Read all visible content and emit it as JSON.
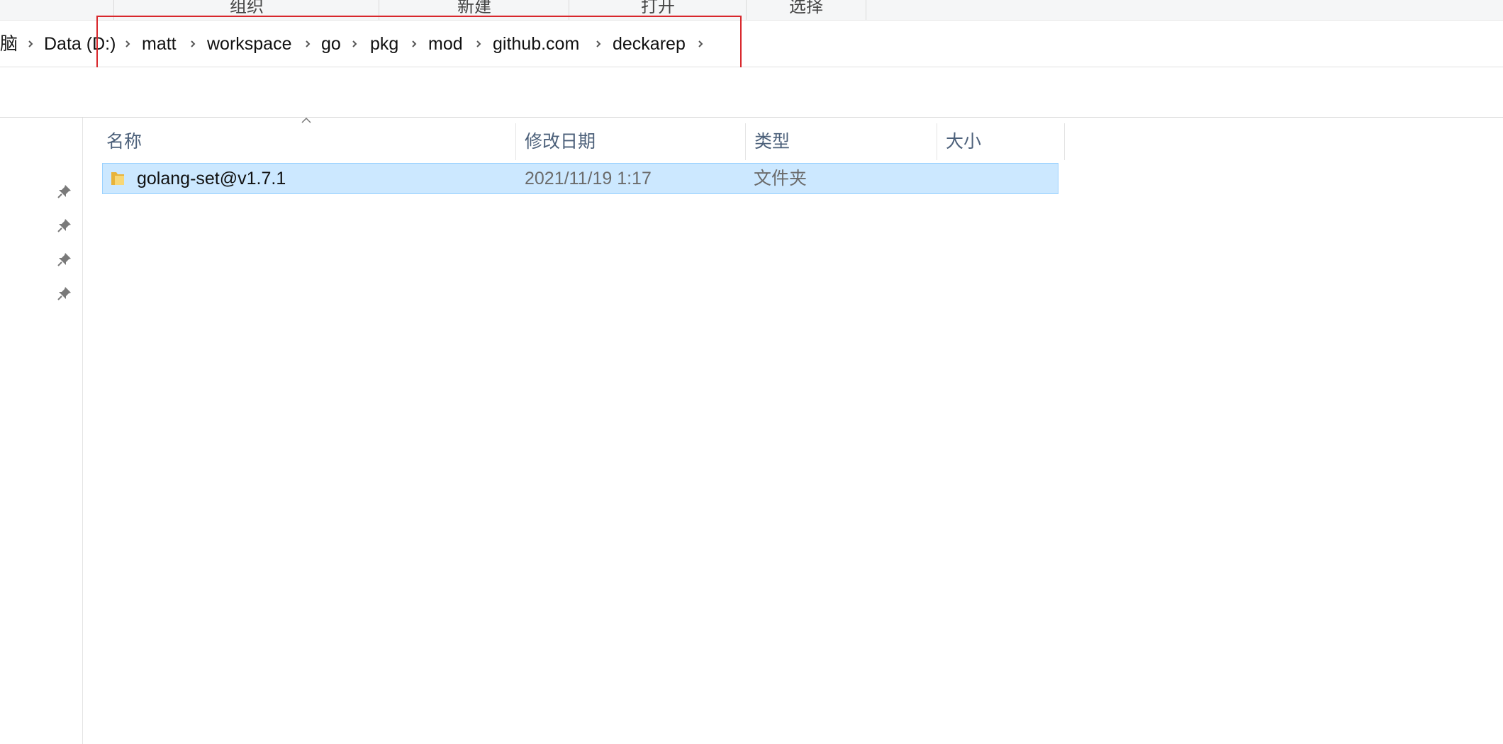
{
  "ribbon": {
    "groups": [
      "组织",
      "新建",
      "打开",
      "选择"
    ]
  },
  "address_bar": {
    "crumbs": [
      "脑",
      "Data (D:)",
      "matt",
      "workspace",
      "go",
      "pkg",
      "mod",
      "github.com",
      "deckarep"
    ]
  },
  "columns": {
    "name": "名称",
    "date_modified": "修改日期",
    "type": "类型",
    "size": "大小"
  },
  "files": [
    {
      "name": "golang-set@v1.7.1",
      "date_modified": "2021/11/19 1:17",
      "type": "文件夹",
      "size": ""
    }
  ],
  "colors": {
    "selection_bg": "#cce8ff",
    "selection_border": "#99d1ff",
    "highlight_box": "#d8272c",
    "header_text": "#4c607a"
  },
  "icons": [
    "chevron-right-icon",
    "pin-icon",
    "folder-icon",
    "sort-up-icon"
  ]
}
